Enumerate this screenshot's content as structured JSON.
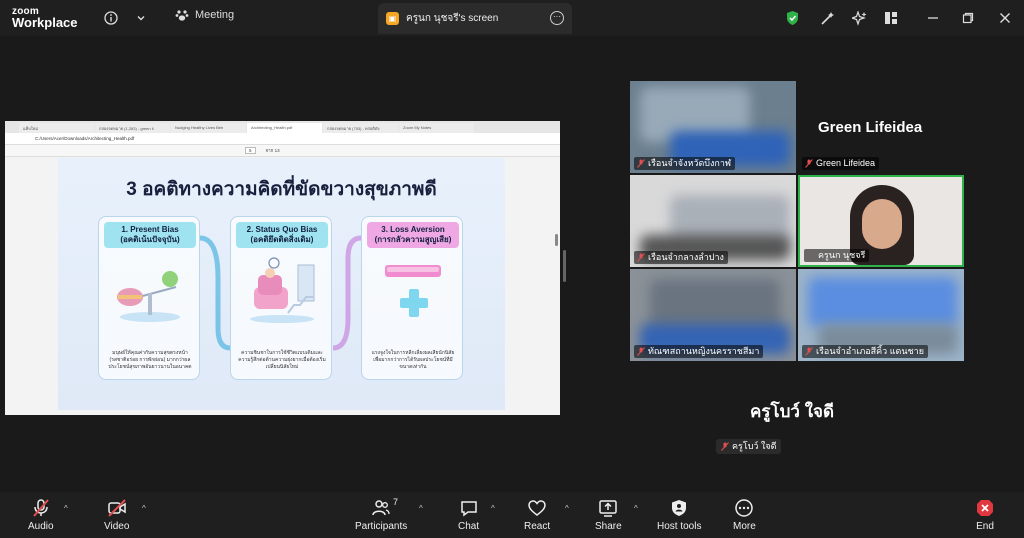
{
  "app": {
    "logo_line1": "zoom",
    "logo_line2": "Workplace"
  },
  "titlebar": {
    "meeting_label": "Meeting",
    "screen_tab_label": "ครูนก นุชจรี's screen"
  },
  "shared_screen": {
    "browser_tabs": [
      "แท็บใหม่",
      "กล่องจดหมาย (1,283) - green li",
      "Nudging Healthy Lives Beh",
      "Architecting_Health.pdf",
      "กล่องจดหมาย (753) - คร่อติดัง",
      "Zoom My Notes"
    ],
    "address": "C:/Users/Acer/Downloads/Architecting_Health.pdf",
    "pdf_page": "5",
    "pdf_total": "จาก 13",
    "slide_title": "3 อคติทางความคิดที่ขัดขวางสุขภาพดี",
    "cards": [
      {
        "title": "1. Present Bias",
        "subtitle": "(อคติเน้นปัจจุบัน)",
        "body": "มนุษย์ให้คุณค่ากับความสุขตรงหน้า (รสชาติอร่อย การพักผ่อน) มากกว่าผลประโยชน์สุขภาพอันยาวนานในอนาคต"
      },
      {
        "title": "2. Status Quo Bias",
        "subtitle": "(อคติยึดติดสิ่งเดิม)",
        "body": "ความชินชาในการใช้ชีวิตแบบเดิมและความรู้สึกต่อต้านความยุ่งยากเมื่อต้องเริ่มเปลี่ยนนิสัยใหม่"
      },
      {
        "title": "3. Loss Aversion",
        "subtitle": "(การกลัวความสูญเสีย)",
        "body": "แรงจูงใจในการหลีกเลี่ยงผลเสียนักนิสัยเพื่อมากกว่าการได้รับผลประโยชน์ที่มีขนาดเท่ากัน"
      }
    ]
  },
  "participants": [
    {
      "name": "เรือนจำจังหวัดบึงกาฬ"
    },
    {
      "name": "Green Lifeidea",
      "display": "Green Lifeidea"
    },
    {
      "name": "เรือนจำกลางลำปาง"
    },
    {
      "name": "ครูนก นุชจรี"
    },
    {
      "name": "ทัณฑสถานหญิงนครราชสีมา"
    },
    {
      "name": "เรือนจำอำเภอสีคิ้ว แดนชาย"
    }
  ],
  "active_speaker": {
    "display": "ครูโบว์ ใจดี",
    "label": "ครูโบว์ ใจดี"
  },
  "toolbar": {
    "audio": "Audio",
    "video": "Video",
    "participants": "Participants",
    "participants_count": "7",
    "chat": "Chat",
    "react": "React",
    "share": "Share",
    "host_tools": "Host tools",
    "more": "More",
    "end": "End"
  },
  "colors": {
    "accent_green": "#2fb24a",
    "end_red": "#e0383e",
    "muted_red": "#e05050"
  }
}
